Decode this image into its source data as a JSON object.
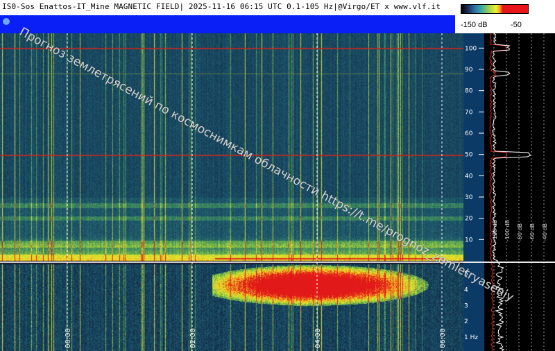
{
  "header": {
    "title": "IS0-Sos Enattos-IT_Mine MAGNETIC FIELD| 2025-11-16 06:15 UTC 0.1-105 Hz|@Virgo/ET x www.vlf.it"
  },
  "colorbar": {
    "min_label": "-150 dB",
    "max_label": "-50",
    "colors": [
      "#000000",
      "#1b2d5a",
      "#2e6fa8",
      "#3aa9a0",
      "#9ed348",
      "#f2f233",
      "#e8161a"
    ]
  },
  "watermark": {
    "text": "Прогноз землетрясений по космоснимкам облачности  https://t.me/prognoz_zemletryaseniy"
  },
  "chart_data": {
    "type": "heatmap",
    "title": "IS0-Sos Enattos-IT_Mine MAGNETIC FIELD| 2025-11-16 06:15 UTC 0.1-105 Hz|@Virgo/ET x www.vlf.it",
    "upper_panel": {
      "yunit": "Hz",
      "ylim": [
        0,
        105
      ],
      "y_ticks": [
        "100",
        "90",
        "80",
        "70",
        "60",
        "50",
        "40",
        "30",
        "20",
        "10"
      ],
      "y_tick_values": [
        100,
        90,
        80,
        70,
        60,
        50,
        40,
        30,
        20,
        10
      ],
      "spectral_lines_hz": [
        100,
        50,
        88
      ],
      "x_time_markers": [
        "00:00",
        "02:00",
        "04:00",
        "06:00"
      ]
    },
    "lower_panel": {
      "y_ticks": [
        "5",
        "4",
        "3",
        "2",
        "1 Hz"
      ],
      "y_tick_values": [
        5,
        4,
        3,
        2,
        1
      ]
    },
    "x_ticks": [
      "00:00",
      "02:00",
      "04:00",
      "06:00"
    ],
    "power_axis_labels": [
      "-120 dB",
      "-100 dB",
      "-80 dB",
      "-60 dB",
      "-40 dB"
    ],
    "power_unit": "dB",
    "colorbar_range_db": [
      -150,
      -50
    ],
    "grid": true
  }
}
